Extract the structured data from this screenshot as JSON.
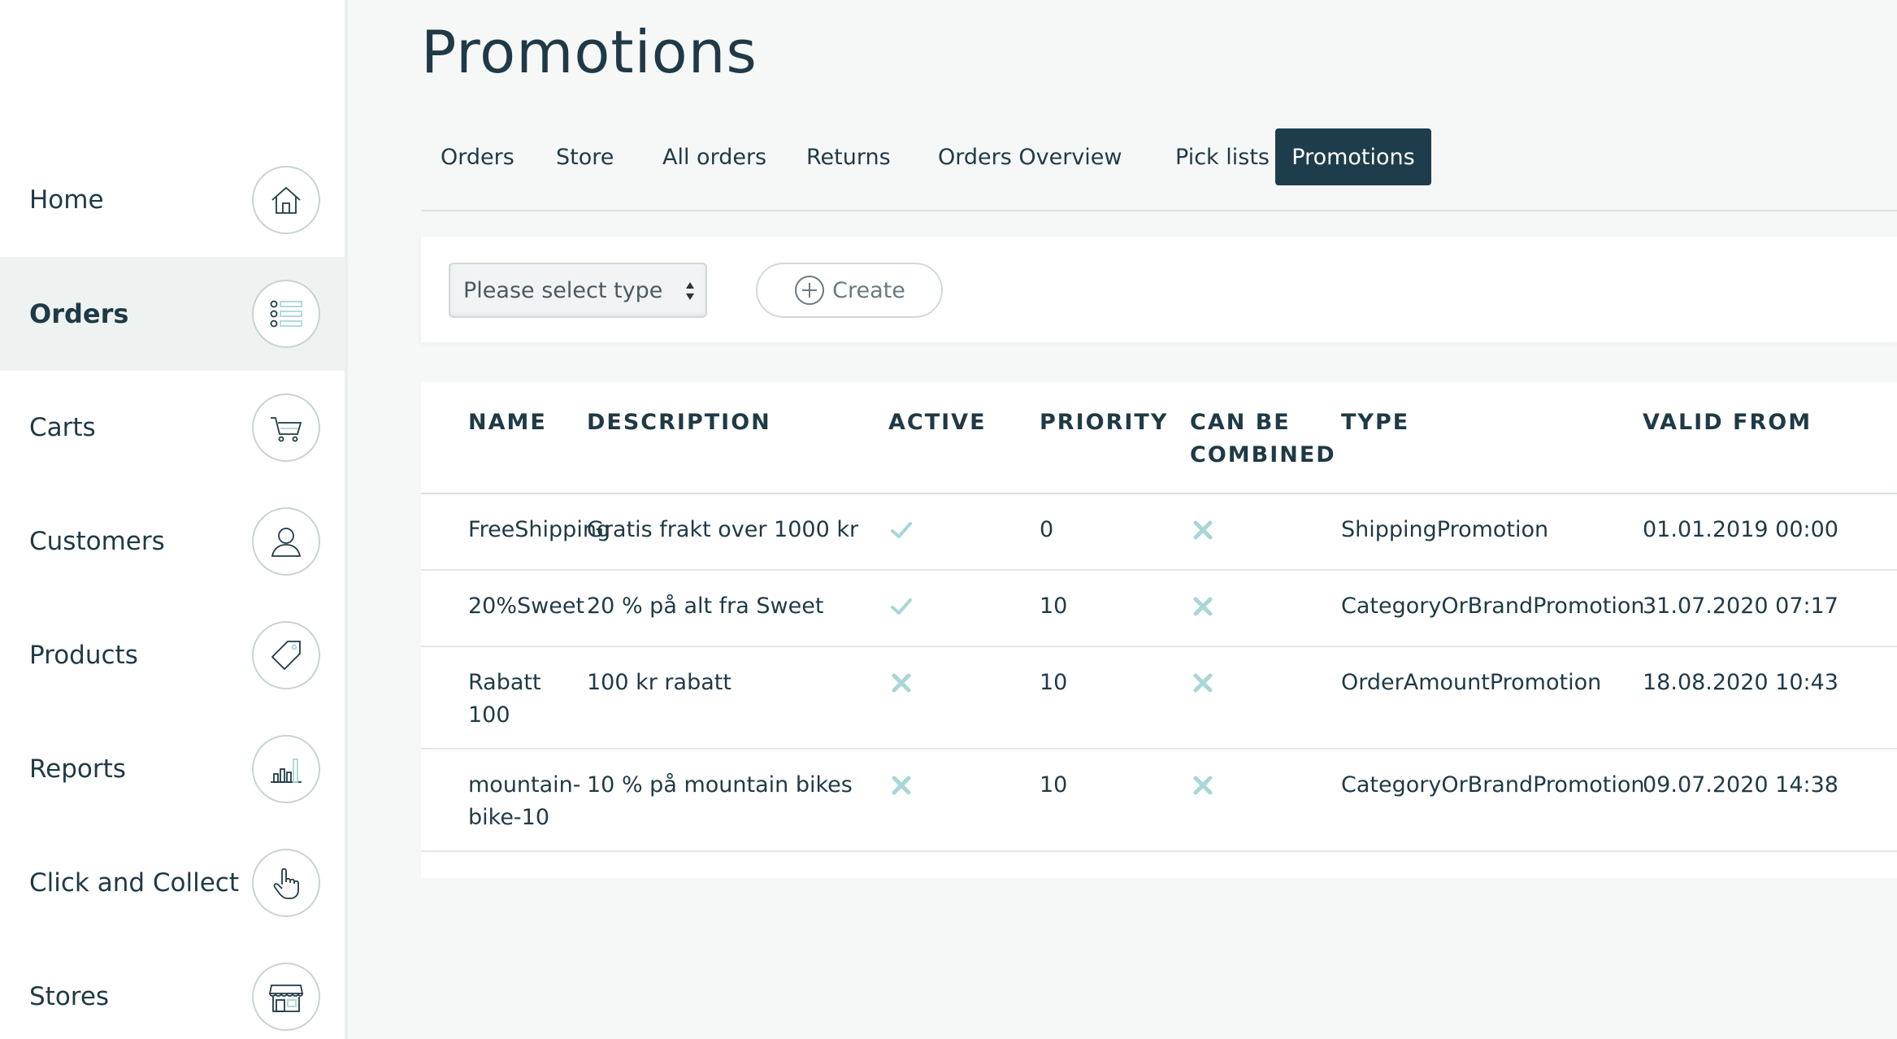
{
  "sidebar": {
    "items": [
      {
        "label": "Home",
        "icon": "home-icon"
      },
      {
        "label": "Orders",
        "icon": "list-icon",
        "active": true
      },
      {
        "label": "Carts",
        "icon": "cart-icon"
      },
      {
        "label": "Customers",
        "icon": "user-icon"
      },
      {
        "label": "Products",
        "icon": "tag-icon"
      },
      {
        "label": "Reports",
        "icon": "bar-chart-icon"
      },
      {
        "label": "Click and Collect",
        "icon": "hand-pointer-icon"
      },
      {
        "label": "Stores",
        "icon": "storefront-icon"
      }
    ]
  },
  "page": {
    "title": "Promotions"
  },
  "tabs": [
    {
      "label": "Orders"
    },
    {
      "label": "Store"
    },
    {
      "label": "All orders"
    },
    {
      "label": "Returns"
    },
    {
      "label": "Orders Overview"
    },
    {
      "label": "Pick lists"
    },
    {
      "label": "Promotions",
      "active": true
    }
  ],
  "toolbar": {
    "type_select": "Please select type",
    "create_label": "Create"
  },
  "table": {
    "headers": {
      "name": "NAME",
      "description": "DESCRIPTION",
      "active": "ACTIVE",
      "priority": "PRIORITY",
      "can_be_combined": "CAN BE COMBINED",
      "type": "TYPE",
      "valid_from": "VALID FROM"
    },
    "rows": [
      {
        "name": "FreeShipping",
        "description": "Gratis frakt over 1000 kr",
        "active": true,
        "priority": "0",
        "can_be_combined": false,
        "type": "ShippingPromotion",
        "valid_from": "01.01.2019 00:00"
      },
      {
        "name": "20%Sweet",
        "description": "20 % på alt fra Sweet",
        "active": true,
        "priority": "10",
        "can_be_combined": false,
        "type": "CategoryOrBrandPromotion",
        "valid_from": "31.07.2020 07:17"
      },
      {
        "name": "Rabatt 100",
        "description": "100 kr rabatt",
        "active": false,
        "priority": "10",
        "can_be_combined": false,
        "type": "OrderAmountPromotion",
        "valid_from": "18.08.2020 10:43"
      },
      {
        "name": "mountain-bike-10",
        "description": "10 % på mountain bikes",
        "active": false,
        "priority": "10",
        "can_be_combined": false,
        "type": "CategoryOrBrandPromotion",
        "valid_from": "09.07.2020 14:38"
      }
    ]
  },
  "colors": {
    "primary": "#1d3d4c",
    "text": "#1f3a46",
    "check": "#a9d6d6",
    "sidebar_active_bg": "#eef3f2"
  }
}
